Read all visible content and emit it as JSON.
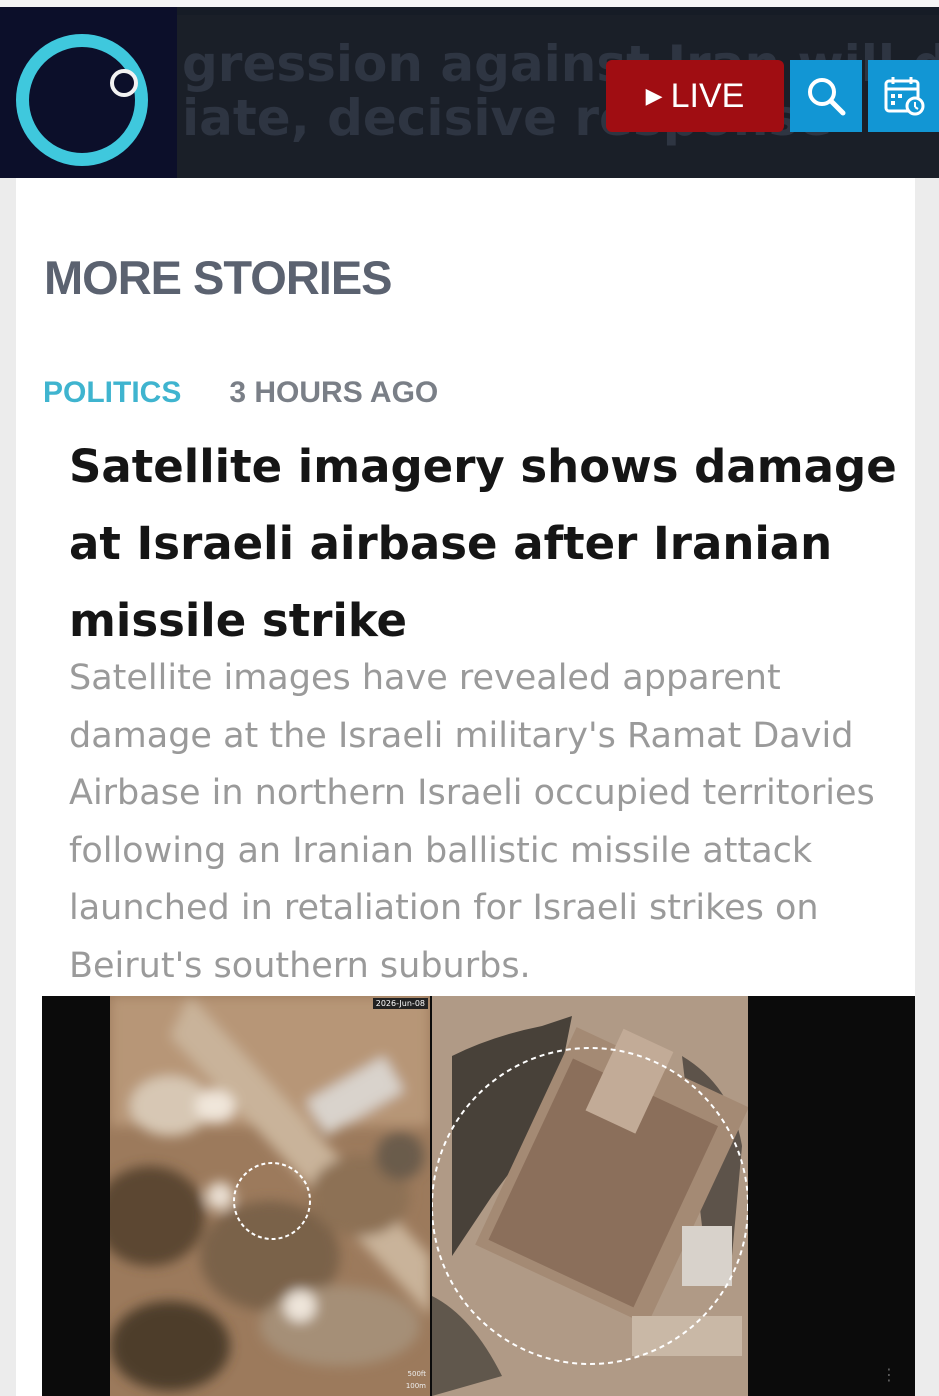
{
  "header": {
    "ticker_line1": "gression against Iran will draw",
    "ticker_line2": "iate, decisive response",
    "live_label": "LIVE",
    "live_icon": "play-triangle-icon",
    "search_icon": "search-icon",
    "schedule_icon": "calendar-clock-icon",
    "colors": {
      "bar": "#161c26",
      "logo_ring": "#3fc8dd",
      "live": "#a00d12",
      "icon_btn": "#1296d4"
    }
  },
  "section": {
    "title": "MORE STORIES"
  },
  "story": {
    "category": "POLITICS",
    "time": "3 HOURS AGO",
    "headline": "Satellite imagery shows damage at Israeli airbase after Iranian missile strike",
    "summary": "Satellite images have revealed apparent damage at the Israeli military's Ramat David Airbase in northern Israeli occupied territories following an Iranian ballistic missile attack launched in retaliation for Israeli strikes on Beirut's southern suburbs.",
    "image": {
      "date_label": "2026-Jun-08",
      "scale_label_1": "500ft",
      "scale_label_2": "100m"
    },
    "colors": {
      "category": "#3fb4cf",
      "time": "#7a7f87"
    }
  }
}
